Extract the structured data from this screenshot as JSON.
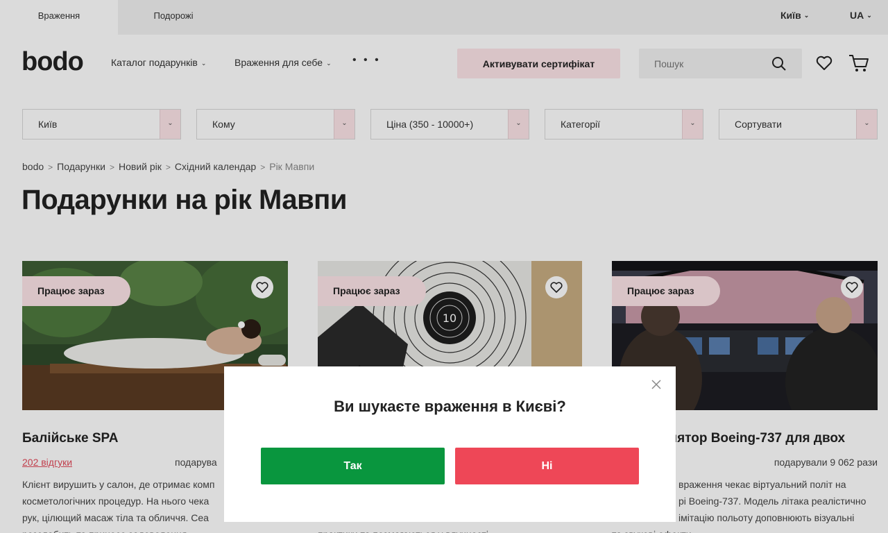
{
  "top_tabs": [
    {
      "label": "Враження",
      "active": true
    },
    {
      "label": "Подорожі",
      "active": false
    }
  ],
  "top_right": {
    "city": "Київ",
    "language": "UA"
  },
  "header": {
    "logo": "bodo",
    "nav": [
      {
        "label": "Каталог подарунків"
      },
      {
        "label": "Враження для себе"
      }
    ],
    "more": "• • •",
    "activate_label": "Активувати сертифікат",
    "search_placeholder": "Пошук"
  },
  "filters": [
    {
      "label": "Київ"
    },
    {
      "label": "Кому"
    },
    {
      "label": "Ціна (350 - 10000+)"
    },
    {
      "label": "Категорії"
    },
    {
      "label": "Сортувати"
    }
  ],
  "breadcrumb": {
    "items": [
      "bodo",
      "Подарунки",
      "Новий рік",
      "Східний календар"
    ],
    "current": "Рік Мавпи",
    "separator": ">"
  },
  "page_title": "Подарунки на рік Мавпи",
  "cards": [
    {
      "badge": "Працює зараз",
      "title": "Балійське SPA",
      "reviews": "202 відгуки",
      "gifted": "подарува",
      "desc_lines": [
        "Клієнт вирушить у салон, де отримає комп",
        "косметологічних процедур. На нього чека",
        "рук, цілющий масаж тіла та обличчя. Сеа",
        "розслабить та принесе задоволення"
      ]
    },
    {
      "badge": "Працює зараз",
      "title": "",
      "reviews": "",
      "gifted": "",
      "desc_lines": [
        "",
        "",
        "",
        "практики та позмагаються у влучності"
      ]
    },
    {
      "badge": "Працює зараз",
      "title": "лятор Boeing-737 для двох",
      "reviews": "",
      "gifted": "подарували 9 062 рази",
      "desc_lines": [
        "враження чекає віртуальний політ на",
        "рі Boeing-737. Модель літака реалістично",
        "імітацію польоту доповнюють візуальні",
        "та звукові ефекти"
      ]
    }
  ],
  "modal": {
    "question": "Ви шукаєте враження в Києві?",
    "yes": "Так",
    "no": "Ні"
  },
  "colors": {
    "accent_pink": "#fde5e8",
    "yes_green": "#09963e",
    "no_red": "#ee4757",
    "review_link": "#e14a5a"
  }
}
